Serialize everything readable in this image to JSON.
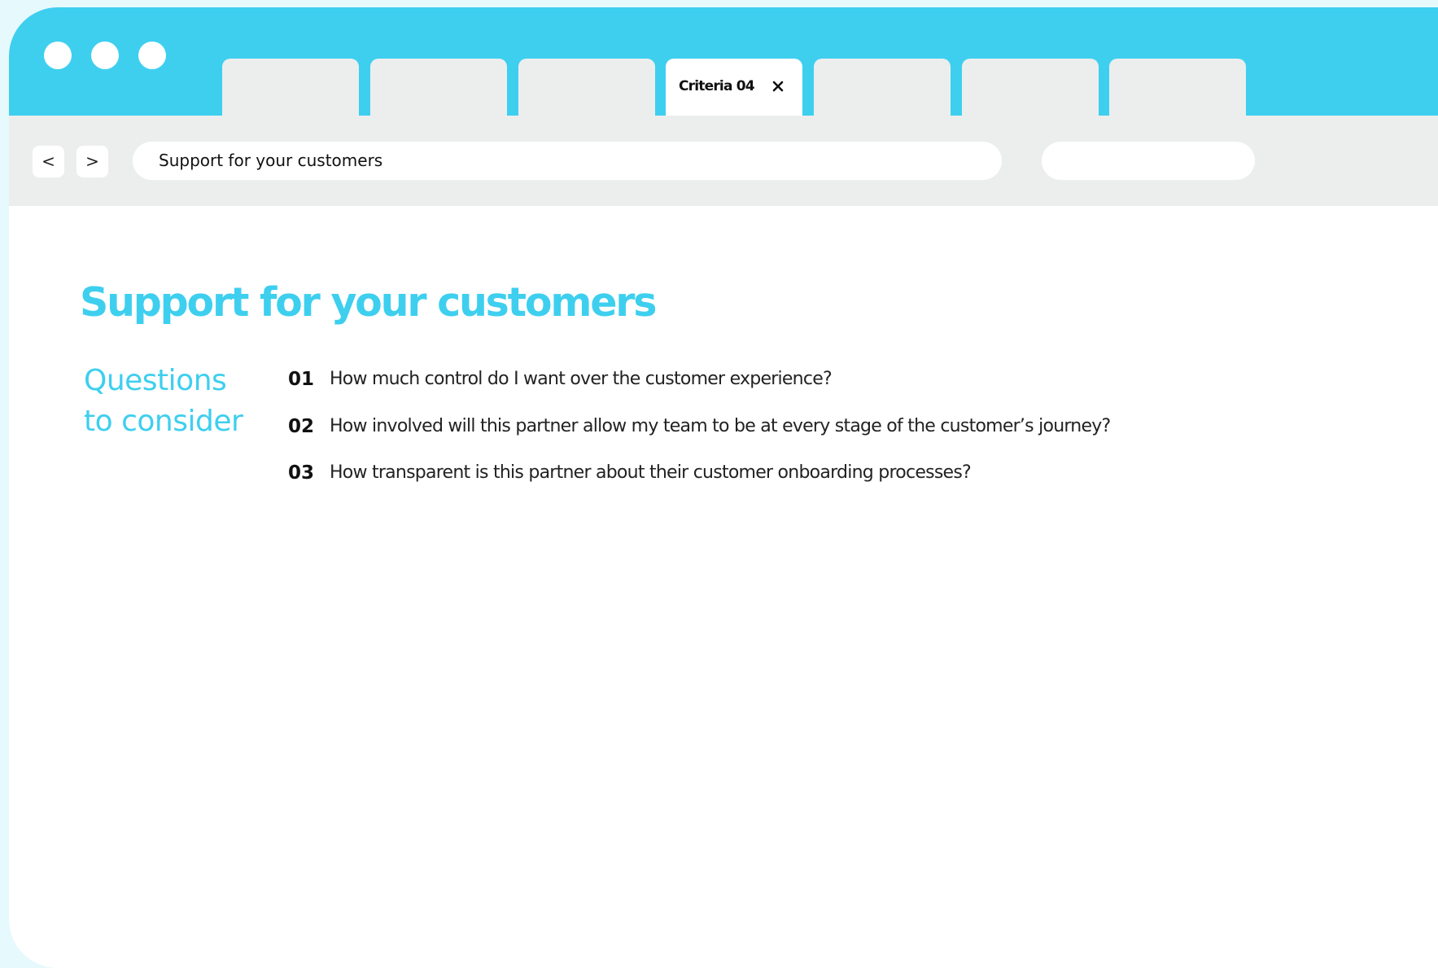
{
  "browser": {
    "tabs": [
      {
        "label": ""
      },
      {
        "label": ""
      },
      {
        "label": ""
      },
      {
        "label": "Criteria 04",
        "active": true
      },
      {
        "label": ""
      },
      {
        "label": ""
      },
      {
        "label": ""
      }
    ],
    "nav": {
      "back_label": "<",
      "forward_label": ">"
    },
    "address": "Support for your customers",
    "search": ""
  },
  "content": {
    "title": "Support for your customers",
    "questions_label_line1": "Questions",
    "questions_label_line2": "to consider",
    "questions": [
      {
        "number": "01",
        "text": "How much control do I want over the customer experience?"
      },
      {
        "number": "02",
        "text": "How involved will this partner allow my team to be at every stage of the customer’s journey?"
      },
      {
        "number": "03",
        "text": "How transparent is this partner about their customer onboarding processes?"
      }
    ]
  },
  "colors": {
    "accent": "#3ecfef",
    "chrome": "#eceeee",
    "background": "#e6f9fd"
  }
}
